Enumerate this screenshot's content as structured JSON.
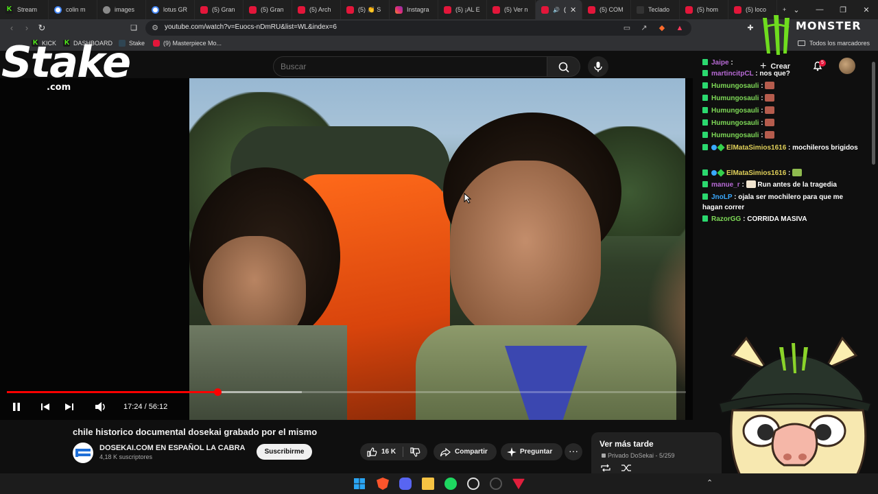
{
  "browser": {
    "tabs": [
      {
        "label": "Stream",
        "icon": "kick-icon"
      },
      {
        "label": "colin m",
        "icon": "google-icon"
      },
      {
        "label": "images",
        "icon": "globe-icon"
      },
      {
        "label": "lotus GR",
        "icon": "google-icon"
      },
      {
        "label": "(5) Gran",
        "icon": "youtube-icon"
      },
      {
        "label": "(5) Gran",
        "icon": "youtube-icon"
      },
      {
        "label": "(5) Arch",
        "icon": "youtube-icon"
      },
      {
        "label": "(5) 👏 S",
        "icon": "youtube-icon"
      },
      {
        "label": "Instagra",
        "icon": "instagram-icon"
      },
      {
        "label": "(5) ¡AL E",
        "icon": "youtube-icon"
      },
      {
        "label": "(5) Ver n",
        "icon": "youtube-icon"
      },
      {
        "label": "(",
        "icon": "youtube-icon",
        "active": true
      },
      {
        "label": "(5) COM",
        "icon": "youtube-icon"
      },
      {
        "label": "Teclado",
        "icon": "dark-icon"
      },
      {
        "label": "(5) hom",
        "icon": "youtube-icon"
      },
      {
        "label": "(5) loco",
        "icon": "youtube-icon"
      }
    ],
    "url": "youtube.com/watch?v=Euocs-nDmRU&list=WL&index=6",
    "bookmarks": [
      {
        "label": "KICK",
        "icon": "kick-icon"
      },
      {
        "label": "DASHBOARD",
        "icon": "kick-icon"
      },
      {
        "label": "Stake",
        "icon": "stake-icon"
      },
      {
        "label": "(9) Masterpiece Mo...",
        "icon": "youtube-icon"
      }
    ],
    "all_bookmarks_label": "Todos los marcadores"
  },
  "youtube": {
    "search_placeholder": "Buscar",
    "create_label": "Crear",
    "notifications_count": "5",
    "video": {
      "current_time": "17:24",
      "duration": "56:12",
      "time_display": "17:24 / 56:12",
      "played_fraction": 0.31,
      "buffered_fraction": 0.434
    },
    "title": "chile historico documental dosekai grabado por el mismo",
    "channel": {
      "name": "DOSEKAI.COM EN ESPAÑOL LA CABRA",
      "subscribers": "4,18 K suscriptores",
      "subscribe_label": "Suscribirme"
    },
    "actions": {
      "likes": "16 K",
      "share_label": "Compartir",
      "ask_label": "Preguntar"
    },
    "playlist": {
      "title": "Ver más tarde",
      "subtitle": "Privado DoSekai - 5/259"
    }
  },
  "overlays": {
    "stake": {
      "word": "Stake",
      "domain": ".com"
    },
    "monster": {
      "word": "MONSTER"
    }
  },
  "chat": [
    {
      "user": "Jaipe",
      "user_color": "#b86ad6",
      "text": ""
    },
    {
      "user": "martincitpCL",
      "user_color": "#b86ad6",
      "text": "nos que?"
    },
    {
      "user": "Humungosauli",
      "user_color": "#7ed957",
      "text": "",
      "emote": true
    },
    {
      "user": "Humungosauli",
      "user_color": "#7ed957",
      "text": "",
      "emote": true
    },
    {
      "user": "Humungosauli",
      "user_color": "#7ed957",
      "text": "",
      "emote": true
    },
    {
      "user": "Humungosauli",
      "user_color": "#7ed957",
      "text": "",
      "emote": true
    },
    {
      "user": "Humungosauli",
      "user_color": "#7ed957",
      "text": "",
      "emote": true
    },
    {
      "user": "ElMataSimios1616",
      "user_color": "#e0d05a",
      "text": "mochileros brigidos",
      "badges": true
    },
    {
      "user": "ElMataSimios1616",
      "user_color": "#e0d05a",
      "text": "",
      "badges": true,
      "emote": "frog"
    },
    {
      "user": "manue_r",
      "user_color": "#b86ad6",
      "text": "Run antes de la tragedia",
      "emote": "cat"
    },
    {
      "user": "JnoLP",
      "user_color": "#3aa9ff",
      "text": "ojala ser mochilero para que me hagan correr"
    },
    {
      "user": "RazorGG",
      "user_color": "#7ed957",
      "text": "CORRIDA MASIVA"
    }
  ],
  "colors": {
    "youtube_red": "#ff0000",
    "kick_green": "#53fc18",
    "background": "#0f0f0f"
  }
}
